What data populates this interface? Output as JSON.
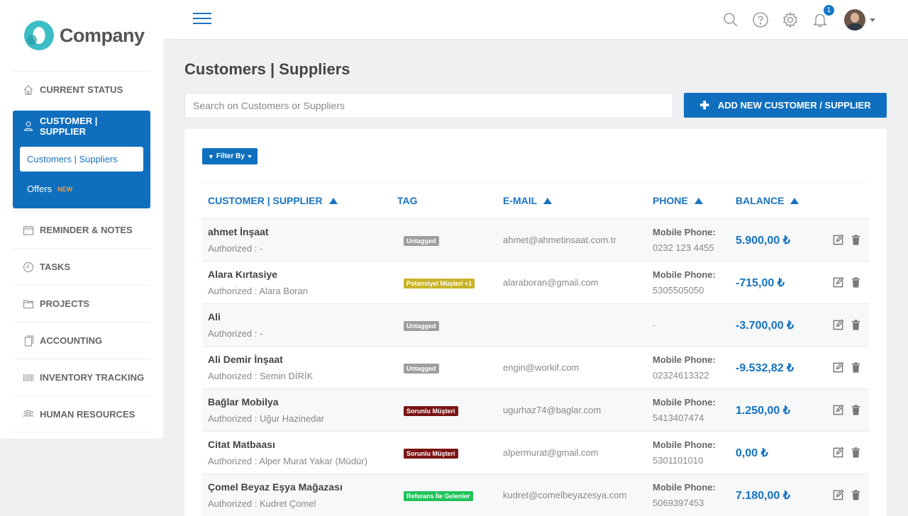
{
  "brand": {
    "name": "Company"
  },
  "sidebar": {
    "items": [
      {
        "label": "CURRENT STATUS",
        "icon": "home-icon"
      },
      {
        "label": "CUSTOMER | SUPPLIER",
        "icon": "user-icon",
        "active": true,
        "children": [
          {
            "label": "Customers | Suppliers",
            "selected": true
          },
          {
            "label": "Offers",
            "badge": "NEW"
          }
        ]
      },
      {
        "label": "REMINDER & NOTES",
        "icon": "calendar-icon"
      },
      {
        "label": "TASKS",
        "icon": "clock-icon"
      },
      {
        "label": "PROJECTS",
        "icon": "folder-icon"
      },
      {
        "label": "ACCOUNTING",
        "icon": "document-icon"
      },
      {
        "label": "INVENTORY TRACKING",
        "icon": "barcode-icon"
      },
      {
        "label": "HUMAN RESOURCES",
        "icon": "people-icon"
      }
    ]
  },
  "topbar": {
    "notification_count": "1"
  },
  "page": {
    "title": "Customers | Suppliers",
    "search_placeholder": "Search on Customers or Suppliers",
    "add_button": "ADD NEW CUSTOMER / SUPPLIER",
    "filter_button": "Filter By"
  },
  "table": {
    "headers": [
      "CUSTOMER | SUPPLIER",
      "TAG",
      "E-MAIL",
      "PHONE",
      "BALANCE"
    ],
    "phone_label": "Mobile Phone:",
    "rows": [
      {
        "name": "ahmet İnşaat",
        "authorized": "Authorized : -",
        "tag": "Untagged",
        "tag_color": "#9e9e9e",
        "email": "ahmet@ahmetinsaat.com.tr",
        "phone": "0232 123 4455",
        "balance": "5.900,00 ₺"
      },
      {
        "name": "Alara Kırtasiye",
        "authorized": "Authorized : Alara Boran",
        "tag": "Potansiyel Müşteri +1",
        "tag_color": "#c9b227",
        "email": "alaraboran@gmail.com",
        "phone": "5305505050",
        "balance": "-715,00 ₺"
      },
      {
        "name": "Ali",
        "authorized": "Authorized : -",
        "tag": "Untagged",
        "tag_color": "#9e9e9e",
        "email": "",
        "phone": "-",
        "balance": "-3.700,00 ₺"
      },
      {
        "name": "Ali Demir İnşaat",
        "authorized": "Authorized : Semin DİRİK",
        "tag": "Untagged",
        "tag_color": "#9e9e9e",
        "email": "engin@workif.com",
        "phone": "02324613322",
        "balance": "-9.532,82 ₺"
      },
      {
        "name": "Bağlar Mobilya",
        "authorized": "Authorized : Uğur Hazinedar",
        "tag": "Sorunlu Müşteri",
        "tag_color": "#7a1414",
        "email": "ugurhaz74@baglar.com",
        "phone": "5413407474",
        "balance": "1.250,00 ₺"
      },
      {
        "name": "Citat Matbaası",
        "authorized": "Authorized : Alper Murat Yakar (Müdür)",
        "tag": "Sorunlu Müşteri",
        "tag_color": "#7a1414",
        "email": "alpermurat@gmail.com",
        "phone": "5301101010",
        "balance": "0,00 ₺"
      },
      {
        "name": "Çomel Beyaz Eşya Mağazası",
        "authorized": "Authorized : Kudret Çomel",
        "tag": "Referans İle Gelenler",
        "tag_color": "#1fc25a",
        "email": "kudret@comelbeyazesya.com",
        "phone": "5069397453",
        "balance": "7.180,00 ₺"
      }
    ]
  }
}
